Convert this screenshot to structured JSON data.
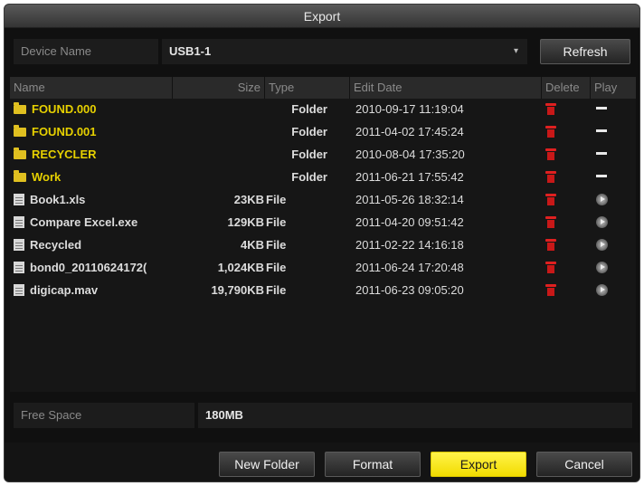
{
  "window": {
    "title": "Export"
  },
  "device": {
    "label": "Device Name",
    "value": "USB1-1",
    "refresh_label": "Refresh"
  },
  "table": {
    "headers": {
      "name": "Name",
      "size": "Size",
      "type": "Type",
      "date": "Edit Date",
      "delete": "Delete",
      "play": "Play"
    },
    "rows": [
      {
        "name": "FOUND.000",
        "size": "",
        "type": "Folder",
        "date": "2010-09-17 11:19:04",
        "kind": "folder"
      },
      {
        "name": "FOUND.001",
        "size": "",
        "type": "Folder",
        "date": "2011-04-02 17:45:24",
        "kind": "folder"
      },
      {
        "name": "RECYCLER",
        "size": "",
        "type": "Folder",
        "date": "2010-08-04 17:35:20",
        "kind": "folder"
      },
      {
        "name": "Work",
        "size": "",
        "type": "Folder",
        "date": "2011-06-21 17:55:42",
        "kind": "folder"
      },
      {
        "name": "Book1.xls",
        "size": "23KB",
        "type": "File",
        "date": "2011-05-26 18:32:14",
        "kind": "file"
      },
      {
        "name": "Compare Excel.exe",
        "size": "129KB",
        "type": "File",
        "date": "2011-04-20 09:51:42",
        "kind": "file"
      },
      {
        "name": "Recycled",
        "size": "4KB",
        "type": "File",
        "date": "2011-02-22 14:16:18",
        "kind": "file"
      },
      {
        "name": "bond0_20110624172(",
        "size": "1,024KB",
        "type": "File",
        "date": "2011-06-24 17:20:48",
        "kind": "file"
      },
      {
        "name": "digicap.mav",
        "size": "19,790KB",
        "type": "File",
        "date": "2011-06-23 09:05:20",
        "kind": "file"
      }
    ]
  },
  "free_space": {
    "label": "Free Space",
    "value": "180MB"
  },
  "buttons": {
    "new_folder": "New Folder",
    "format": "Format",
    "export": "Export",
    "cancel": "Cancel"
  },
  "icons": {
    "folder": "folder-icon",
    "file": "file-icon",
    "delete": "trash-icon",
    "play": "play-icon",
    "no_play": "dash-icon"
  },
  "colors": {
    "folder_text": "#e6d000",
    "export_button": "#f7e600",
    "delete_icon": "#e02020"
  }
}
